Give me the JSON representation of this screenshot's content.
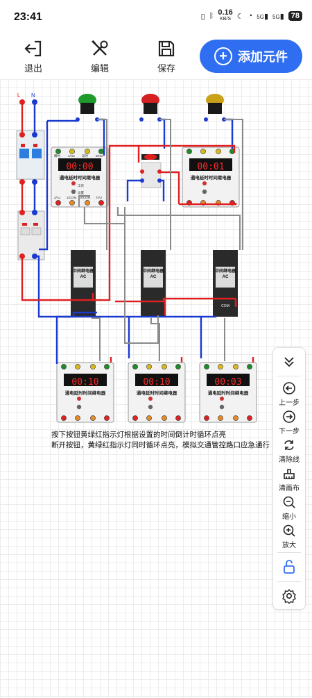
{
  "status_bar": {
    "time": "23:41",
    "net_speed": "0.16",
    "net_unit": "KB/S",
    "signal1": "5G",
    "signal2": "5G",
    "battery": "78"
  },
  "toolbar": {
    "exit_label": "退出",
    "edit_label": "编辑",
    "save_label": "保存",
    "add_component_label": "添加元件"
  },
  "canvas": {
    "breaker_labels": {
      "L": "L",
      "N": "N"
    },
    "timer_title": "通电延时时间继电器",
    "timer_top_labels": [
      "瞬时",
      "4/NC",
      "延时",
      "8/NO"
    ],
    "timer_bottom_labels": [
      "2/A1",
      "1/COM",
      "8/COM",
      "7/A2"
    ],
    "timer_work": "工作",
    "timer_set": "设置",
    "timers": [
      {
        "display": "00:00"
      },
      {
        "display": "00:01"
      },
      {
        "display": "00:10"
      },
      {
        "display": "00:10"
      },
      {
        "display": "00:03"
      }
    ],
    "relay_title": "中间继电器",
    "relay_sub": "AC",
    "relay_com": "COM",
    "notes": [
      "按下按钮黄绿红指示灯根据设置的时间倒计时循环点亮",
      "断开按钮，黄绿红指示灯同时循环点亮，模拟交通管控路口应急通行"
    ]
  },
  "side_panel": {
    "collapse_icon": "chevron-double-down-icon",
    "undo_label": "上一步",
    "redo_label": "下一步",
    "clear_wires_label": "清除线",
    "clear_canvas_label": "清画布",
    "zoom_out_label": "缩小",
    "zoom_in_label": "放大"
  },
  "colors": {
    "accent": "#2f6ef0",
    "wire_red": "#e02020",
    "wire_blue": "#1a3ad0",
    "wire_gray": "#8a8a8a",
    "lamp_green": "#1f9a2c",
    "lamp_red": "#d42020",
    "lamp_yellow": "#c9a21a",
    "timer_display": "#ff2a2a"
  }
}
